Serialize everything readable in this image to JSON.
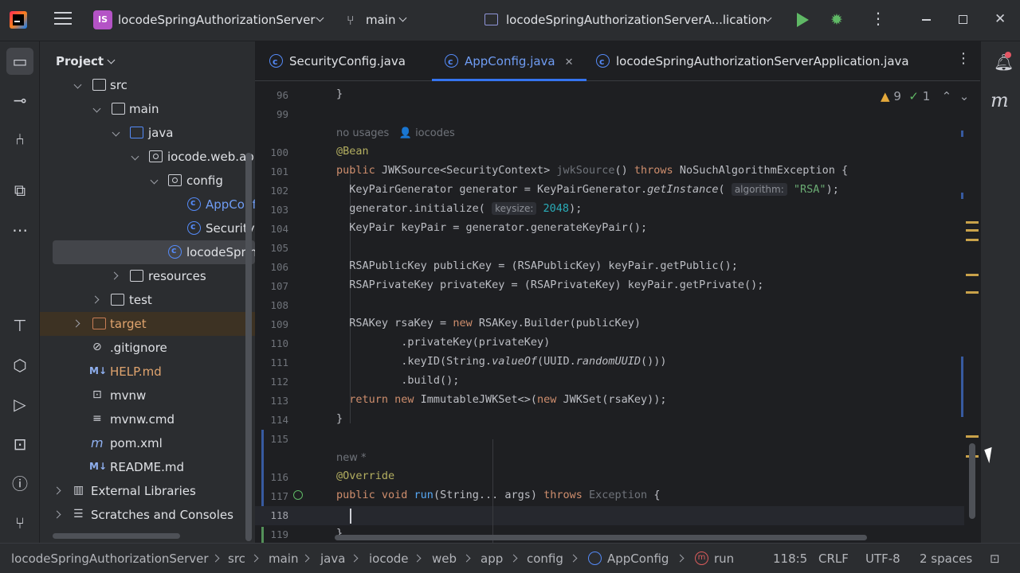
{
  "titlebar": {
    "project_badge": "IS",
    "project_name": "locodeSpringAuthorizationServer",
    "branch": "main",
    "run_config": "locodeSpringAuthorizationServerA...lication"
  },
  "project_panel": {
    "title": "Project",
    "tree": [
      {
        "label": "src"
      },
      {
        "label": "main"
      },
      {
        "label": "java"
      },
      {
        "label": "iocode.web.app"
      },
      {
        "label": "config"
      },
      {
        "label": "AppConfig"
      },
      {
        "label": "SecurityConfig"
      },
      {
        "label": "locodeSpringAuthorizationServerApplication"
      },
      {
        "label": "resources"
      },
      {
        "label": "test"
      },
      {
        "label": "target"
      },
      {
        "label": ".gitignore"
      },
      {
        "label": "HELP.md"
      },
      {
        "label": "mvnw"
      },
      {
        "label": "mvnw.cmd"
      },
      {
        "label": "pom.xml"
      },
      {
        "label": "README.md"
      },
      {
        "label": "External Libraries"
      },
      {
        "label": "Scratches and Consoles"
      }
    ]
  },
  "tabs": [
    {
      "label": "SecurityConfig.java"
    },
    {
      "label": "AppConfig.java"
    },
    {
      "label": "locodeSpringAuthorizationServerApplication.java"
    }
  ],
  "inspections": {
    "warnings": "9",
    "ok": "1"
  },
  "editor": {
    "line_numbers": [
      "96",
      "99",
      "100",
      "101",
      "102",
      "103",
      "104",
      "105",
      "106",
      "107",
      "108",
      "109",
      "110",
      "111",
      "112",
      "113",
      "114",
      "115",
      "116",
      "117",
      "118",
      "119"
    ],
    "hint_usages": "no usages",
    "hint_author": "iocodes",
    "hint_new": "new *"
  },
  "statusbar": {
    "crumbs": [
      "locodeSpringAuthorizationServer",
      "src",
      "main",
      "java",
      "iocode",
      "web",
      "app",
      "config",
      "AppConfig",
      "run"
    ],
    "position": "118:5",
    "line_sep": "CRLF",
    "encoding": "UTF-8",
    "indent": "2 spaces"
  }
}
